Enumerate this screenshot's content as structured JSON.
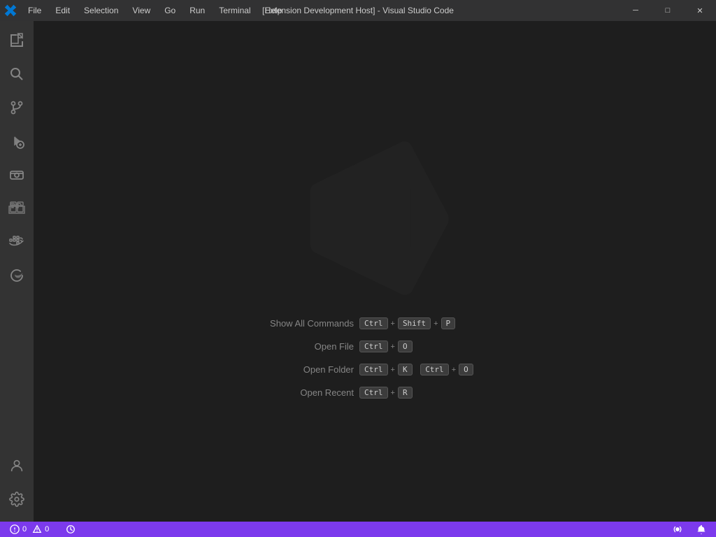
{
  "titlebar": {
    "title": "[Extension Development Host] - Visual Studio Code",
    "menu": [
      "File",
      "Edit",
      "Selection",
      "View",
      "Go",
      "Run",
      "Terminal",
      "Help"
    ],
    "controls": {
      "minimize": "─",
      "maximize": "□",
      "close": "✕"
    }
  },
  "activity_bar": {
    "items": [
      {
        "name": "explorer",
        "label": "Explorer",
        "active": false
      },
      {
        "name": "search",
        "label": "Search",
        "active": false
      },
      {
        "name": "source-control",
        "label": "Source Control",
        "active": false
      },
      {
        "name": "run-debug",
        "label": "Run and Debug",
        "active": false
      },
      {
        "name": "remote-explorer",
        "label": "Remote Explorer",
        "active": false
      },
      {
        "name": "extensions",
        "label": "Extensions",
        "active": false
      },
      {
        "name": "docker",
        "label": "Docker",
        "active": false
      },
      {
        "name": "edge",
        "label": "Microsoft Edge Tools",
        "active": false
      }
    ],
    "bottom": [
      {
        "name": "accounts",
        "label": "Accounts"
      },
      {
        "name": "settings",
        "label": "Settings"
      }
    ]
  },
  "welcome": {
    "shortcuts": [
      {
        "label": "Show All Commands",
        "keys": [
          "Ctrl",
          "+",
          "Shift",
          "+",
          "P"
        ]
      },
      {
        "label": "Open File",
        "keys": [
          "Ctrl",
          "+",
          "O"
        ]
      },
      {
        "label": "Open Folder",
        "keys1": [
          "Ctrl",
          "+",
          "K"
        ],
        "keys2": [
          "Ctrl",
          "+",
          "O"
        ]
      },
      {
        "label": "Open Recent",
        "keys": [
          "Ctrl",
          "+",
          "R"
        ]
      }
    ]
  },
  "statusbar": {
    "left": [
      {
        "icon": "error",
        "text": "⊗ 0"
      },
      {
        "icon": "warning",
        "text": "⚠ 0"
      },
      {
        "icon": "history",
        "text": ""
      }
    ],
    "right": [
      {
        "text": ""
      },
      {
        "text": "🔔"
      }
    ]
  }
}
